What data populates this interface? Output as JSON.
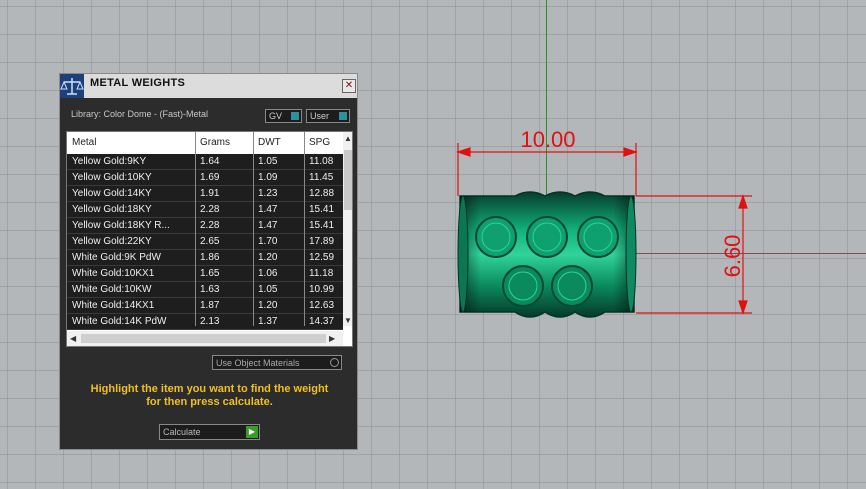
{
  "panel": {
    "title": "METAL WEIGHTS",
    "library_label": "Library: Color Dome - (Fast)-Metal",
    "gv_label": "GV",
    "user_label": "User",
    "columns": [
      "Metal",
      "Grams",
      "DWT",
      "SPG"
    ],
    "rows": [
      {
        "metal": "Yellow Gold:9KY",
        "grams": "1.64",
        "dwt": "1.05",
        "spg": "11.08"
      },
      {
        "metal": "Yellow Gold:10KY",
        "grams": "1.69",
        "dwt": "1.09",
        "spg": "11.45"
      },
      {
        "metal": "Yellow Gold:14KY",
        "grams": "1.91",
        "dwt": "1.23",
        "spg": "12.88"
      },
      {
        "metal": "Yellow Gold:18KY",
        "grams": "2.28",
        "dwt": "1.47",
        "spg": "15.41"
      },
      {
        "metal": "Yellow Gold:18KY R...",
        "grams": "2.28",
        "dwt": "1.47",
        "spg": "15.41"
      },
      {
        "metal": "Yellow Gold:22KY",
        "grams": "2.65",
        "dwt": "1.70",
        "spg": "17.89"
      },
      {
        "metal": "White Gold:9K PdW",
        "grams": "1.86",
        "dwt": "1.20",
        "spg": "12.59"
      },
      {
        "metal": "White Gold:10KX1",
        "grams": "1.65",
        "dwt": "1.06",
        "spg": "11.18"
      },
      {
        "metal": "White Gold:10KW",
        "grams": "1.63",
        "dwt": "1.05",
        "spg": "10.99"
      },
      {
        "metal": "White Gold:14KX1",
        "grams": "1.87",
        "dwt": "1.20",
        "spg": "12.63"
      },
      {
        "metal": "White Gold:14K PdW",
        "grams": "2.13",
        "dwt": "1.37",
        "spg": "14.37"
      }
    ],
    "use_object_materials": "Use Object Materials",
    "hint_line1": "Highlight the item you want to find the weight",
    "hint_line2": "for then press calculate.",
    "calculate_label": "Calculate"
  },
  "viewport": {
    "width_dimension": "10.00",
    "height_dimension": "6.60",
    "dimension_color": "#e01010",
    "model_color": "#0f9a6a"
  },
  "icons": {
    "panel_icon": "metal-scale-icon",
    "close": "close-icon",
    "scroll_up": "arrow-up-icon",
    "scroll_down": "arrow-down-icon",
    "scroll_left": "arrow-left-icon",
    "scroll_right": "arrow-right-icon"
  }
}
